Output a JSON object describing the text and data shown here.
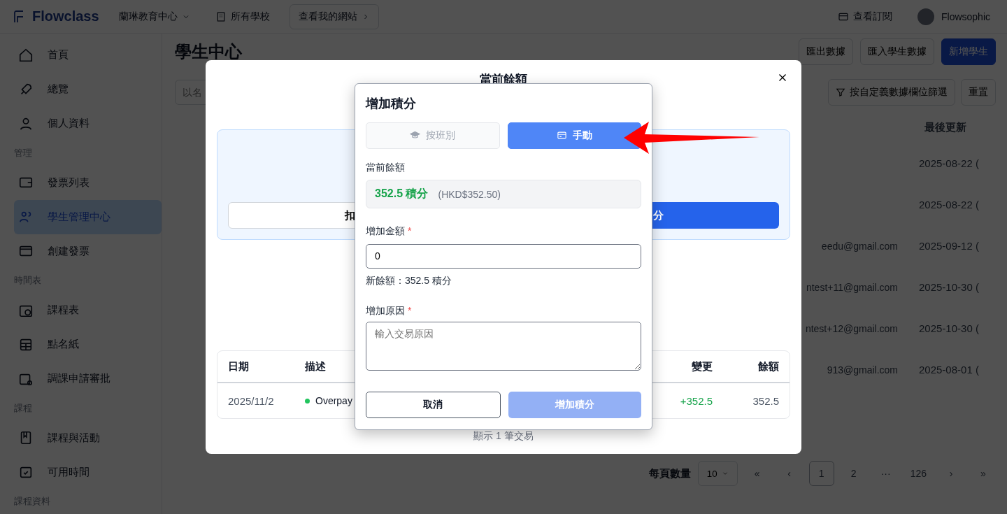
{
  "header": {
    "logo": "Flowclass",
    "school": "蘭琳教育中心",
    "all_schools": "所有學校",
    "view_site": "查看我的網站",
    "subscription": "查看訂閱",
    "user": "Flowsophic"
  },
  "sidebar": {
    "entries": [
      {
        "kind": "item",
        "label": "首頁",
        "selected": false
      },
      {
        "kind": "item",
        "label": "總覽",
        "selected": false
      },
      {
        "kind": "item",
        "label": "個人資料",
        "selected": false
      },
      {
        "kind": "section",
        "label": "管理"
      },
      {
        "kind": "item",
        "label": "發票列表",
        "selected": false
      },
      {
        "kind": "item",
        "label": "學生管理中心",
        "selected": true
      },
      {
        "kind": "item",
        "label": "創建發票",
        "selected": false
      },
      {
        "kind": "section",
        "label": "時間表"
      },
      {
        "kind": "item",
        "label": "課程表",
        "selected": false
      },
      {
        "kind": "item",
        "label": "點名紙",
        "selected": false
      },
      {
        "kind": "item",
        "label": "調課申請審批",
        "selected": false
      },
      {
        "kind": "section",
        "label": "課程"
      },
      {
        "kind": "item",
        "label": "課程與活動",
        "selected": false
      },
      {
        "kind": "item",
        "label": "可用時間",
        "selected": false
      },
      {
        "kind": "section",
        "label": "課程資料"
      }
    ]
  },
  "page": {
    "title": "學生中心",
    "actions": [
      {
        "label": "匯出數據",
        "primary": false
      },
      {
        "label": "匯入學生數據",
        "primary": false
      },
      {
        "label": "新增學生",
        "primary": true
      }
    ],
    "search_placeholder": "以名",
    "filter": "按自定義數據欄位篩選",
    "reset": "重置",
    "column": "最後更新",
    "rows": [
      {
        "date": "2025-08-22 ("
      },
      {
        "date": "2025-08-22 ("
      },
      {
        "email": "eedu@gmail.com",
        "date": "2025-09-12 ("
      },
      {
        "email": "ntest+11@gmail.com",
        "date": "2025-10-30 ("
      },
      {
        "email": "ntest+12@gmail.com",
        "date": "2025-10-30 ("
      },
      {
        "email": "913@gmail.com",
        "date": "2025-08-01 ("
      }
    ],
    "pagination": {
      "label": "每頁數量",
      "page_size": "10",
      "pages": [
        {
          "label": "«",
          "selected": false
        },
        {
          "label": "‹",
          "selected": false
        },
        {
          "label": "1",
          "selected": true
        },
        {
          "label": "2",
          "selected": false
        },
        {
          "label": "···",
          "selected": false
        },
        {
          "label": "126",
          "selected": false
        },
        {
          "label": "›",
          "selected": false
        },
        {
          "label": "»",
          "selected": false
        }
      ]
    }
  },
  "balance_modal": {
    "title": "當前餘額",
    "deduct_button": "扣",
    "add_button": "分",
    "table": {
      "columns": [
        "日期",
        "描述",
        "變更",
        "餘額"
      ],
      "rows": [
        {
          "date": "2025/11/2",
          "description": "Overpay",
          "color": "#22c55e",
          "change": "+352.5",
          "balance": "352.5"
        }
      ]
    },
    "footer": "顯示 1 筆交易"
  },
  "add_dialog": {
    "title": "增加積分",
    "modes": [
      {
        "label": "按班別",
        "selected": false
      },
      {
        "label": "手動",
        "selected": true
      }
    ],
    "balance_label": "當前餘額",
    "balance_points": "352.5 積分",
    "balance_money": "(HKD$352.50)",
    "amount_label": "增加金額",
    "amount_required_mark": "*",
    "amount_value": "0",
    "new_balance": "新餘額：352.5 積分",
    "reason_label": "增加原因",
    "reason_required_mark": "*",
    "reason_placeholder": "輸入交易原因",
    "cancel": "取消",
    "submit": {
      "label": "增加積分",
      "disabled": true
    }
  }
}
